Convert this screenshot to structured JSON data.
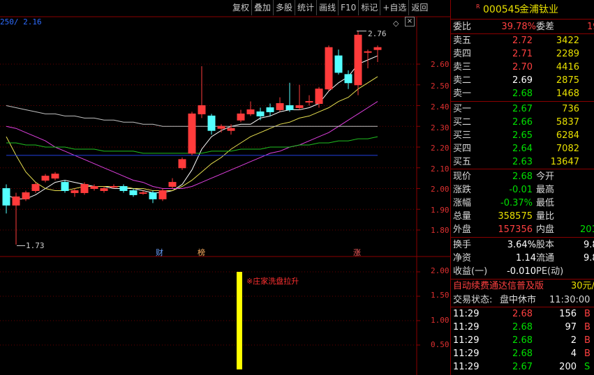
{
  "toolbar": {
    "items": [
      "复权",
      "叠加",
      "多股",
      "统计",
      "画线",
      "F10",
      "标记",
      "+自选",
      "返回"
    ]
  },
  "main_chart": {
    "ma_legend": "250/ 2.16",
    "price_ticks": [
      "2.60",
      "2.50",
      "2.40",
      "2.30",
      "2.20",
      "2.10",
      "2.00",
      "1.90",
      "1.80"
    ],
    "high_label": "2.76",
    "low_label": "1.73",
    "event_markers": [
      {
        "text": "财",
        "color": "#6aa0ff"
      },
      {
        "text": "榜",
        "color": "#ffb060"
      },
      {
        "text": "涨",
        "color": "#ff6060"
      }
    ]
  },
  "chart_data": {
    "type": "candlestick",
    "ylim": [
      1.75,
      2.8
    ],
    "candles": [
      [
        2.0,
        1.92,
        2.02,
        1.88
      ],
      [
        1.92,
        1.96,
        1.98,
        1.73
      ],
      [
        1.95,
        1.98,
        1.99,
        1.94
      ],
      [
        1.99,
        2.02,
        2.03,
        1.98
      ],
      [
        2.04,
        2.06,
        2.07,
        2.03
      ],
      [
        2.05,
        2.07,
        2.08,
        2.04
      ],
      [
        2.03,
        1.99,
        2.04,
        1.98
      ],
      [
        1.98,
        1.99,
        2.0,
        1.96
      ],
      [
        1.98,
        2.02,
        2.03,
        1.97
      ],
      [
        2.0,
        2.01,
        2.02,
        1.99
      ],
      [
        1.99,
        2.0,
        2.01,
        1.98
      ],
      [
        2.01,
        2.01,
        2.02,
        2.0
      ],
      [
        2.01,
        1.99,
        2.02,
        1.98
      ],
      [
        1.99,
        1.97,
        2.0,
        1.96
      ],
      [
        1.98,
        1.98,
        1.99,
        1.97
      ],
      [
        1.98,
        1.95,
        1.99,
        1.93
      ],
      [
        1.95,
        1.99,
        2.0,
        1.94
      ],
      [
        2.01,
        2.03,
        2.05,
        2.0
      ],
      [
        2.1,
        2.14,
        2.15,
        2.09
      ],
      [
        2.17,
        2.36,
        2.37,
        2.16
      ],
      [
        2.36,
        2.4,
        2.59,
        2.34
      ],
      [
        2.35,
        2.28,
        2.36,
        2.26
      ],
      [
        2.29,
        2.3,
        2.31,
        2.27
      ],
      [
        2.28,
        2.29,
        2.31,
        2.26
      ],
      [
        2.33,
        2.36,
        2.38,
        2.32
      ],
      [
        2.36,
        2.38,
        2.42,
        2.35
      ],
      [
        2.37,
        2.35,
        2.39,
        2.33
      ],
      [
        2.39,
        2.37,
        2.41,
        2.35
      ],
      [
        2.38,
        2.41,
        2.44,
        2.37
      ],
      [
        2.4,
        2.38,
        2.51,
        2.37
      ],
      [
        2.39,
        2.4,
        2.5,
        2.38
      ],
      [
        2.42,
        2.42,
        2.45,
        2.4
      ],
      [
        2.41,
        2.48,
        2.49,
        2.39
      ],
      [
        2.48,
        2.68,
        2.69,
        2.47
      ],
      [
        2.64,
        2.56,
        2.67,
        2.55
      ],
      [
        2.55,
        2.51,
        2.57,
        2.48
      ],
      [
        2.5,
        2.74,
        2.76,
        2.45
      ],
      [
        2.66,
        2.66,
        2.67,
        2.58
      ],
      [
        2.67,
        2.68,
        2.69,
        2.61
      ]
    ],
    "ma_lines": [
      {
        "color": "#ffffff",
        "values": [
          1.97,
          1.95,
          1.95,
          1.97,
          2.0,
          2.03,
          2.04,
          2.03,
          2.02,
          2.01,
          2.01,
          2.0,
          2.0,
          2.0,
          1.99,
          1.98,
          1.98,
          1.99,
          2.02,
          2.09,
          2.19,
          2.25,
          2.28,
          2.3,
          2.31,
          2.31,
          2.34,
          2.35,
          2.37,
          2.38,
          2.38,
          2.39,
          2.41,
          2.47,
          2.51,
          2.54,
          2.6,
          2.62,
          2.64
        ]
      },
      {
        "color": "#e8e050",
        "values": [
          2.25,
          2.16,
          2.08,
          2.03,
          2.0,
          1.99,
          1.99,
          2.0,
          2.01,
          2.01,
          2.01,
          2.01,
          2.01,
          2.0,
          2.0,
          1.99,
          1.99,
          1.99,
          2.01,
          2.04,
          2.08,
          2.12,
          2.15,
          2.19,
          2.22,
          2.25,
          2.27,
          2.29,
          2.31,
          2.32,
          2.34,
          2.35,
          2.37,
          2.39,
          2.42,
          2.44,
          2.48,
          2.51,
          2.54
        ]
      },
      {
        "color": "#e040e0",
        "values": [
          2.3,
          2.29,
          2.27,
          2.25,
          2.23,
          2.2,
          2.18,
          2.16,
          2.14,
          2.12,
          2.1,
          2.08,
          2.06,
          2.04,
          2.03,
          2.01,
          2.0,
          2.0,
          2.0,
          2.01,
          2.03,
          2.05,
          2.07,
          2.09,
          2.11,
          2.13,
          2.15,
          2.17,
          2.18,
          2.2,
          2.21,
          2.23,
          2.25,
          2.27,
          2.3,
          2.33,
          2.36,
          2.39,
          2.42
        ]
      },
      {
        "color": "#c0c0c0",
        "values": [
          2.4,
          2.39,
          2.38,
          2.37,
          2.36,
          2.36,
          2.35,
          2.35,
          2.34,
          2.34,
          2.33,
          2.33,
          2.32,
          2.32,
          2.31,
          2.31,
          2.3,
          2.3,
          2.3,
          2.3,
          2.3,
          2.3,
          2.3,
          2.3,
          2.3,
          2.3,
          2.3,
          2.3,
          2.3,
          2.3,
          2.3,
          2.3,
          2.3,
          2.3,
          2.3,
          2.3,
          2.3,
          2.3,
          2.3
        ]
      },
      {
        "color": "#20c020",
        "values": [
          2.22,
          2.22,
          2.21,
          2.21,
          2.2,
          2.2,
          2.2,
          2.19,
          2.19,
          2.19,
          2.18,
          2.18,
          2.18,
          2.18,
          2.17,
          2.17,
          2.17,
          2.17,
          2.17,
          2.17,
          2.17,
          2.18,
          2.18,
          2.18,
          2.19,
          2.19,
          2.19,
          2.2,
          2.2,
          2.2,
          2.21,
          2.21,
          2.22,
          2.22,
          2.23,
          2.23,
          2.24,
          2.24,
          2.25
        ]
      },
      {
        "color": "#2040e0",
        "values": [
          2.16,
          2.16,
          2.16,
          2.16,
          2.16,
          2.16,
          2.16,
          2.16,
          2.16,
          2.16,
          2.16,
          2.16,
          2.16,
          2.16,
          2.16,
          2.16,
          2.16,
          2.16,
          2.16,
          2.16,
          2.16,
          2.16,
          2.16,
          2.16,
          2.16,
          2.16,
          2.16,
          2.16,
          2.16,
          2.16,
          2.16,
          2.16,
          2.16,
          2.16,
          2.16,
          2.16,
          2.16,
          2.16,
          2.16
        ]
      }
    ],
    "sub_chart": {
      "ticks": [
        "2.00",
        "1.50",
        "1.00",
        "0.50"
      ],
      "bar_value": 2.0,
      "bar_index": 23,
      "signal_text": "※庄家洗盘拉升"
    }
  },
  "stock": {
    "flag": "R",
    "code": "000545",
    "name": "金浦钛业"
  },
  "order_book": {
    "ratio_label": "委比",
    "ratio_value": "39.78%",
    "diff_label": "委差",
    "diff_value": "19",
    "sells": [
      {
        "label": "卖五",
        "price": "2.72",
        "vol": "3422"
      },
      {
        "label": "卖四",
        "price": "2.71",
        "vol": "2289"
      },
      {
        "label": "卖三",
        "price": "2.70",
        "vol": "4416"
      },
      {
        "label": "卖二",
        "price": "2.69",
        "vol": "2875"
      },
      {
        "label": "卖一",
        "price": "2.68",
        "vol": "1468"
      }
    ],
    "buys": [
      {
        "label": "买一",
        "price": "2.67",
        "vol": "736"
      },
      {
        "label": "买二",
        "price": "2.66",
        "vol": "5837"
      },
      {
        "label": "买三",
        "price": "2.65",
        "vol": "6284"
      },
      {
        "label": "买四",
        "price": "2.64",
        "vol": "7082"
      },
      {
        "label": "买五",
        "price": "2.63",
        "vol": "13647"
      }
    ]
  },
  "quote": {
    "price_label": "现价",
    "price": "2.68",
    "open_label": "今开",
    "change_label": "涨跌",
    "change": "-0.01",
    "high_label": "最高",
    "pct_label": "涨幅",
    "pct": "-0.37%",
    "low_label": "最低",
    "volume_label": "总量",
    "volume": "358575",
    "vratio_label": "量比",
    "outer_label": "外盘",
    "outer": "157356",
    "inner_label": "内盘",
    "inner": "201"
  },
  "stats": {
    "turnover_label": "换手",
    "turnover": "3.64%",
    "equity_label": "股本",
    "equity": "9.8",
    "net_label": "净资",
    "net": "1.14",
    "float_label": "流通",
    "float": "9.8",
    "eps_label": "收益(一)",
    "eps": "-0.010",
    "pe_label": "PE(动)"
  },
  "promo": {
    "text": "自动续费通达信普及版",
    "price": "30元/"
  },
  "trade_status": {
    "label": "交易状态:",
    "status": "盘中休市",
    "time": "11:30:00"
  },
  "ticks": [
    {
      "time": "11:29",
      "price": "2.68",
      "vol": "156",
      "side": "B"
    },
    {
      "time": "11:29",
      "price": "2.68",
      "vol": "97",
      "side": "B"
    },
    {
      "time": "11:29",
      "price": "2.68",
      "vol": "2",
      "side": "B"
    },
    {
      "time": "11:29",
      "price": "2.68",
      "vol": "4",
      "side": "B"
    },
    {
      "time": "11:29",
      "price": "2.67",
      "vol": "200",
      "side": "S"
    },
    {
      "time": "11:29",
      "price": "2.68",
      "vol": "6",
      "side": "B"
    }
  ]
}
